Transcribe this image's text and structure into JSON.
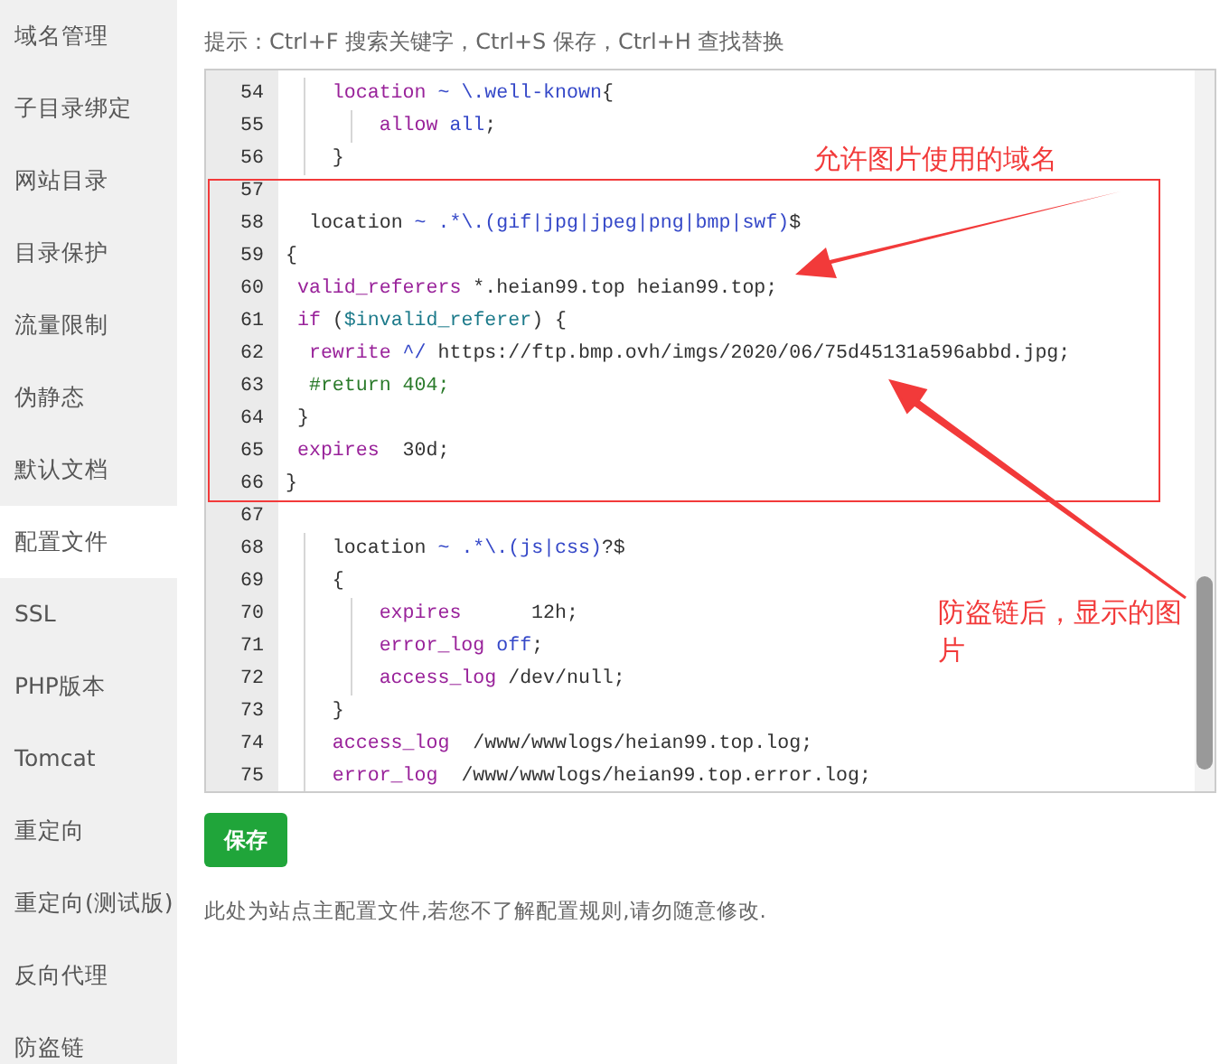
{
  "sidebar": {
    "items": [
      {
        "label": "域名管理",
        "selected": false
      },
      {
        "label": "子目录绑定",
        "selected": false
      },
      {
        "label": "网站目录",
        "selected": false
      },
      {
        "label": "目录保护",
        "selected": false
      },
      {
        "label": "流量限制",
        "selected": false
      },
      {
        "label": "伪静态",
        "selected": false
      },
      {
        "label": "默认文档",
        "selected": false
      },
      {
        "label": "配置文件",
        "selected": true
      },
      {
        "label": "SSL",
        "selected": false
      },
      {
        "label": "PHP版本",
        "selected": false
      },
      {
        "label": "Tomcat",
        "selected": false
      },
      {
        "label": "重定向",
        "selected": false
      },
      {
        "label": "重定向(测试版)",
        "selected": false
      },
      {
        "label": "反向代理",
        "selected": false
      },
      {
        "label": "防盗链",
        "selected": false
      }
    ]
  },
  "hint": "提示：Ctrl+F 搜索关键字，Ctrl+S 保存，Ctrl+H 查找替换",
  "editor": {
    "lines": [
      {
        "number": "54",
        "tokens": [
          {
            "kind": "keyword",
            "text": "    location"
          },
          {
            "kind": "value",
            "text": " ~ \\.well-known"
          },
          {
            "kind": "plain",
            "text": "{"
          }
        ]
      },
      {
        "number": "55",
        "tokens": [
          {
            "kind": "keyword",
            "text": "        allow"
          },
          {
            "kind": "value",
            "text": " all"
          },
          {
            "kind": "plain",
            "text": ";"
          }
        ]
      },
      {
        "number": "56",
        "tokens": [
          {
            "kind": "plain",
            "text": "    }"
          }
        ]
      },
      {
        "number": "57"
      },
      {
        "number": "58",
        "tokens": [
          {
            "kind": "plain",
            "text": "  location"
          },
          {
            "kind": "value",
            "text": " ~ .*\\.(gif|jpg|jpeg|png|bmp|swf)"
          },
          {
            "kind": "plain",
            "text": "$"
          }
        ]
      },
      {
        "number": "59",
        "tokens": [
          {
            "kind": "plain",
            "text": "{"
          }
        ]
      },
      {
        "number": "60",
        "tokens": [
          {
            "kind": "keyword",
            "text": " valid_referers"
          },
          {
            "kind": "plain",
            "text": " *.heian99.top heian99.top;"
          }
        ]
      },
      {
        "number": "61",
        "tokens": [
          {
            "kind": "keyword",
            "text": " if"
          },
          {
            "kind": "plain",
            "text": " ("
          },
          {
            "kind": "variable",
            "text": "$invalid_referer"
          },
          {
            "kind": "plain",
            "text": ") {"
          }
        ]
      },
      {
        "number": "62",
        "tokens": [
          {
            "kind": "keyword",
            "text": "  rewrite"
          },
          {
            "kind": "value",
            "text": " ^/"
          },
          {
            "kind": "plain",
            "text": " https://ftp.bmp.ovh/imgs/2020/06/75d45131a596abbd.jpg;"
          }
        ]
      },
      {
        "number": "63",
        "tokens": [
          {
            "kind": "comment",
            "text": "  #return 404;"
          }
        ]
      },
      {
        "number": "64",
        "tokens": [
          {
            "kind": "plain",
            "text": " }"
          }
        ]
      },
      {
        "number": "65",
        "tokens": [
          {
            "kind": "keyword",
            "text": " expires"
          },
          {
            "kind": "plain",
            "text": "  30d;"
          }
        ]
      },
      {
        "number": "66",
        "tokens": [
          {
            "kind": "plain",
            "text": "}"
          }
        ]
      },
      {
        "number": "67"
      },
      {
        "number": "68",
        "tokens": [
          {
            "kind": "plain",
            "text": "    location"
          },
          {
            "kind": "value",
            "text": " ~ .*\\.(js|css)"
          },
          {
            "kind": "plain",
            "text": "?$"
          }
        ]
      },
      {
        "number": "69",
        "tokens": [
          {
            "kind": "plain",
            "text": "    {"
          }
        ]
      },
      {
        "number": "70",
        "tokens": [
          {
            "kind": "keyword",
            "text": "        expires"
          },
          {
            "kind": "plain",
            "text": "      12h;"
          }
        ]
      },
      {
        "number": "71",
        "tokens": [
          {
            "kind": "keyword",
            "text": "        error_log"
          },
          {
            "kind": "value",
            "text": " off"
          },
          {
            "kind": "plain",
            "text": ";"
          }
        ]
      },
      {
        "number": "72",
        "tokens": [
          {
            "kind": "keyword",
            "text": "        access_log"
          },
          {
            "kind": "plain",
            "text": " /dev/null;"
          }
        ]
      },
      {
        "number": "73",
        "tokens": [
          {
            "kind": "plain",
            "text": "    }"
          }
        ]
      },
      {
        "number": "74",
        "tokens": [
          {
            "kind": "keyword",
            "text": "    access_log"
          },
          {
            "kind": "plain",
            "text": "  /www/wwwlogs/heian99.top.log;"
          }
        ]
      },
      {
        "number": "75",
        "tokens": [
          {
            "kind": "keyword",
            "text": "    error_log"
          },
          {
            "kind": "plain",
            "text": "  /www/wwwlogs/heian99.top.error.log;"
          }
        ]
      }
    ]
  },
  "save_button": "保存",
  "note": "此处为站点主配置文件,若您不了解配置规则,请勿随意修改.",
  "annotations": [
    {
      "text": "允许图片使用的域名"
    },
    {
      "text": "防盗链后，显示的图片"
    }
  ]
}
